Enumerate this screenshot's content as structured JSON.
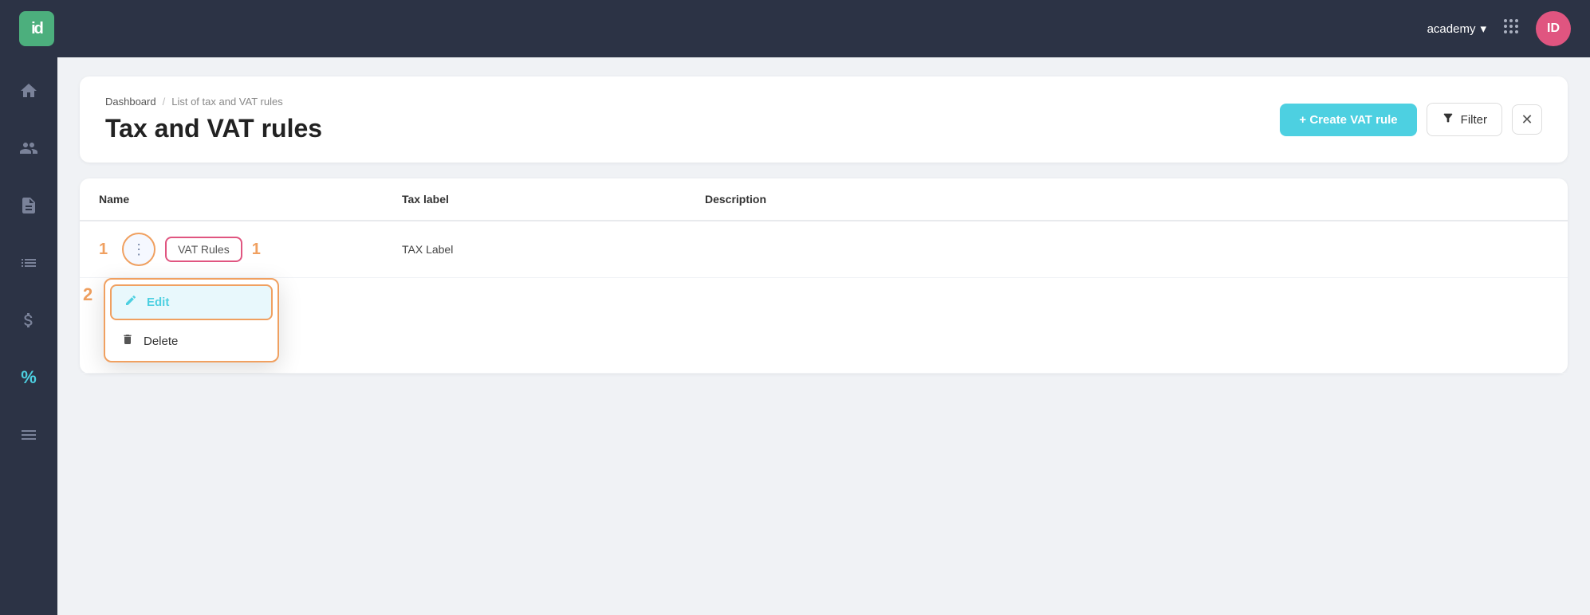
{
  "navbar": {
    "logo": "id",
    "academy_label": "academy",
    "chevron": "▾",
    "apps_icon": "⠿",
    "avatar_label": "ID"
  },
  "sidebar": {
    "items": [
      {
        "name": "home",
        "icon": "⌂",
        "active": false
      },
      {
        "name": "users",
        "icon": "👥",
        "active": false
      },
      {
        "name": "documents",
        "icon": "📄",
        "active": false
      },
      {
        "name": "list",
        "icon": "📋",
        "active": false
      },
      {
        "name": "billing",
        "icon": "💲",
        "active": false
      },
      {
        "name": "tax",
        "icon": "%",
        "active": true
      },
      {
        "name": "reports",
        "icon": "≡",
        "active": false
      }
    ]
  },
  "breadcrumb": {
    "dashboard": "Dashboard",
    "separator": "/",
    "current": "List of tax and VAT rules"
  },
  "page_title": "Tax and VAT rules",
  "buttons": {
    "create_vat": "+ Create VAT rule",
    "filter": "Filter",
    "close": "✕"
  },
  "table": {
    "columns": [
      "Name",
      "Tax label",
      "Description"
    ],
    "rows": [
      {
        "name": "VAT Rules",
        "tax_label": "TAX Label",
        "description": ""
      }
    ]
  },
  "dropdown": {
    "items": [
      {
        "label": "Edit",
        "icon": "✏️",
        "type": "edit"
      },
      {
        "label": "Delete",
        "icon": "🗑",
        "type": "delete"
      }
    ]
  },
  "steps": {
    "step1_left": "1",
    "step1_right": "1",
    "step2": "2"
  },
  "colors": {
    "accent_cyan": "#4dd0e1",
    "accent_orange": "#f0a060",
    "accent_pink": "#e05580",
    "sidebar_bg": "#2c3345"
  }
}
